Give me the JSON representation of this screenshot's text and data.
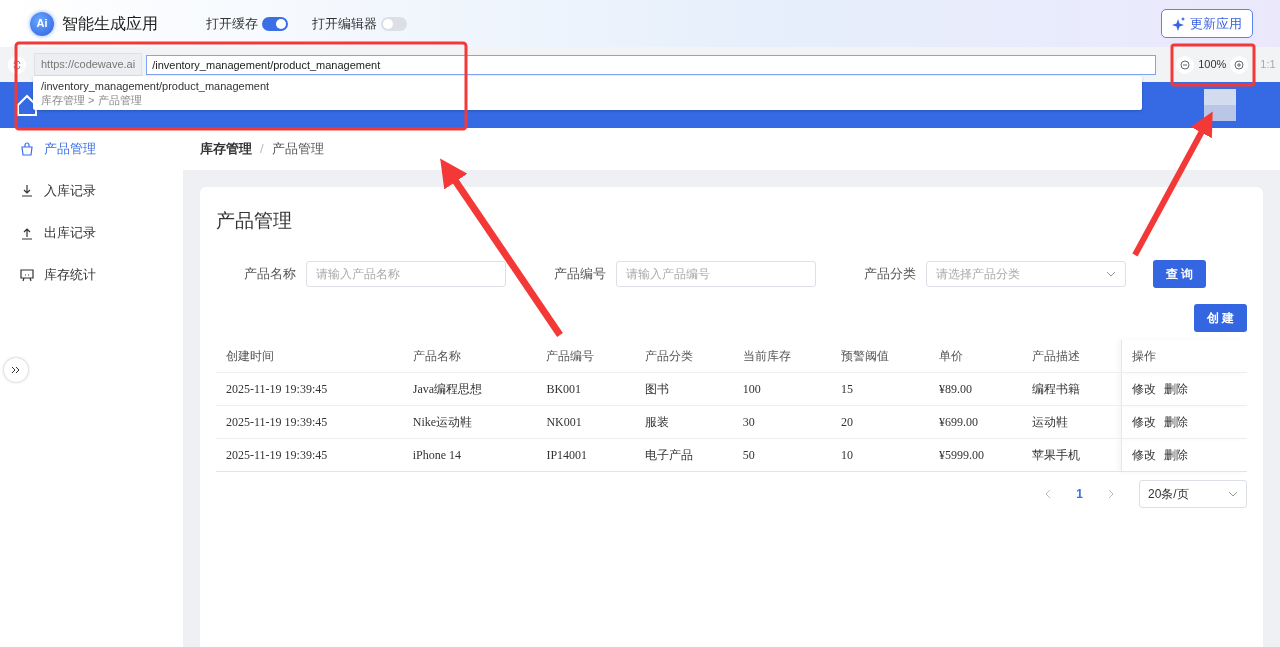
{
  "app": {
    "logo": "Ai",
    "title": "智能生成应用",
    "toggles": [
      {
        "label": "打开缓存",
        "on": true
      },
      {
        "label": "打开编辑器",
        "on": false
      }
    ],
    "update_button": "更新应用"
  },
  "address_bar": {
    "origin": "https://codewave.ai",
    "path": "/inventory_management/product_management",
    "suggestion": {
      "path": "/inventory_management/product_management",
      "breadcrumb": "库存管理 > 产品管理"
    },
    "zoom": "100%",
    "reset": "1:1"
  },
  "sidebar": {
    "items": [
      {
        "label": "产品管理",
        "selected": true
      },
      {
        "label": "入库记录",
        "selected": false
      },
      {
        "label": "出库记录",
        "selected": false
      },
      {
        "label": "库存统计",
        "selected": false
      }
    ]
  },
  "breadcrumb": {
    "items": [
      "库存管理",
      "产品管理"
    ],
    "separator": "/"
  },
  "page_title": "产品管理",
  "filters": [
    {
      "label": "产品名称",
      "placeholder": "请输入产品名称",
      "kind": "input"
    },
    {
      "label": "产品编号",
      "placeholder": "请输入产品编号",
      "kind": "input"
    },
    {
      "label": "产品分类",
      "placeholder": "请选择产品分类",
      "kind": "select"
    }
  ],
  "query_button": "查 询",
  "create_button": "创 建",
  "table": {
    "columns": [
      "创建时间",
      "产品名称",
      "产品编号",
      "产品分类",
      "当前库存",
      "预警阈值",
      "单价",
      "产品描述",
      "操作"
    ],
    "rows": [
      {
        "cells": [
          "2025-11-19 19:39:45",
          "Java编程思想",
          "BK001",
          "图书",
          "100",
          "15",
          "¥89.00",
          "编程书籍"
        ],
        "actions": [
          "修改",
          "删除"
        ]
      },
      {
        "cells": [
          "2025-11-19 19:39:45",
          "Nike运动鞋",
          "NK001",
          "服装",
          "30",
          "20",
          "¥699.00",
          "运动鞋"
        ],
        "actions": [
          "修改",
          "删除"
        ]
      },
      {
        "cells": [
          "2025-11-19 19:39:45",
          "iPhone 14",
          "IP14001",
          "电子产品",
          "50",
          "10",
          "¥5999.00",
          "苹果手机"
        ],
        "actions": [
          "修改",
          "删除"
        ]
      }
    ]
  },
  "pagination": {
    "pages": [
      {
        "label": "1",
        "selected": true
      }
    ],
    "page_size": "20条/页"
  }
}
